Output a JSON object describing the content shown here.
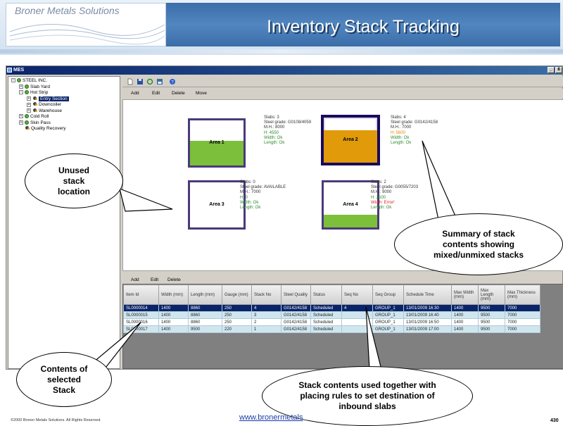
{
  "header": {
    "company": "Broner Metals Solutions",
    "title": "Inventory Stack Tracking"
  },
  "app": {
    "title": "MES",
    "controls": [
      "_",
      "8"
    ]
  },
  "tree": [
    {
      "label": "STEEL INC.",
      "level": 0,
      "exp": "−",
      "icon": "plant"
    },
    {
      "label": "Slab Yard",
      "level": 1,
      "exp": "+",
      "icon": "plant"
    },
    {
      "label": "Hot Strip",
      "level": 1,
      "exp": "−",
      "icon": "plant"
    },
    {
      "label": "Entry Section",
      "level": 2,
      "exp": "+",
      "icon": "gear",
      "selected": true
    },
    {
      "label": "Downcoiler",
      "level": 2,
      "exp": "+",
      "icon": "gear"
    },
    {
      "label": "Warehouse",
      "level": 2,
      "exp": "+",
      "icon": "gear"
    },
    {
      "label": "Cold Roll",
      "level": 1,
      "exp": "+",
      "icon": "plant"
    },
    {
      "label": "Skin Pass",
      "level": 1,
      "exp": "+",
      "icon": "plant"
    },
    {
      "label": "Quality Recovery",
      "level": 1,
      "exp": "",
      "icon": "gear"
    }
  ],
  "toolbar_icons": [
    "new-doc-icon",
    "save-icon",
    "refresh-icon",
    "disk-icon",
    "help-icon"
  ],
  "stack_actions": [
    "Add",
    "Edit",
    "Delete",
    "Move"
  ],
  "areas": [
    {
      "name": "Area 1",
      "fill_fraction": 0.55,
      "fill_color": "#7cbf3a",
      "selected": false,
      "info": [
        {
          "text": "Slabs: 3",
          "cls": ""
        },
        {
          "text": "Steel grade: G0108/4059",
          "cls": ""
        },
        {
          "text": "M.H.: 8000",
          "cls": ""
        },
        {
          "text": "H: 4550",
          "cls": "grn"
        },
        {
          "text": "Width: Ok",
          "cls": "grn"
        },
        {
          "text": "Length: Ok",
          "cls": "grn"
        }
      ]
    },
    {
      "name": "Area 2",
      "fill_fraction": 0.72,
      "fill_color": "#e09a0a",
      "selected": true,
      "info": [
        {
          "text": "Slabs: 4",
          "cls": ""
        },
        {
          "text": "Steel grade: G0142/4158",
          "cls": ""
        },
        {
          "text": "M.H.: 7000",
          "cls": ""
        },
        {
          "text": "H: 5600",
          "cls": "ora"
        },
        {
          "text": "Width: Ok",
          "cls": "grn"
        },
        {
          "text": "Length: Ok",
          "cls": "grn"
        }
      ]
    },
    {
      "name": "Area 3",
      "fill_fraction": 0.0,
      "fill_color": "#ffffff",
      "selected": false,
      "info": [
        {
          "text": "Slabs: 0",
          "cls": ""
        },
        {
          "text": "Steel grade: AVAILABLE",
          "cls": ""
        },
        {
          "text": "M.H.: 7000",
          "cls": ""
        },
        {
          "text": "H: 0",
          "cls": "grn"
        },
        {
          "text": "Width: Ok",
          "cls": "grn"
        },
        {
          "text": "Length: Ok",
          "cls": "grn"
        }
      ]
    },
    {
      "name": "Area 4",
      "fill_fraction": 0.28,
      "fill_color": "#7cbf3a",
      "selected": false,
      "info": [
        {
          "text": "Slabs: 2",
          "cls": ""
        },
        {
          "text": "Steel grade: G0055/7203",
          "cls": ""
        },
        {
          "text": "M.H.: 9000",
          "cls": ""
        },
        {
          "text": "H: 2500",
          "cls": "grn"
        },
        {
          "text": "Width: Error!",
          "cls": "red"
        },
        {
          "text": "Length: Ok",
          "cls": "grn"
        }
      ]
    }
  ],
  "grid_actions": [
    "Add",
    "Edit",
    "Delete"
  ],
  "grid": {
    "columns": [
      "Item Id",
      "Width (mm)",
      "Length (mm)",
      "Gauge (mm)",
      "Stack No",
      "Steel Quality",
      "Status",
      "Seq No",
      "Seq Group",
      "Schedule Time",
      "Max Width (mm)",
      "Max Length (mm)",
      "Max Thickness (mm)"
    ],
    "rows": [
      [
        "SL0000014",
        "1400",
        "8860",
        "250",
        "4",
        "G0142/4158",
        "Scheduled",
        "4",
        "GROUP_1",
        "13/01/2009 16:30",
        "1400",
        "9500",
        "7000"
      ],
      [
        "SL0000015",
        "1400",
        "8860",
        "250",
        "3",
        "G0142/4158",
        "Scheduled",
        "",
        "GROUP_1",
        "13/01/2009 16:40",
        "1400",
        "9500",
        "7000"
      ],
      [
        "SL0000016",
        "1400",
        "8860",
        "250",
        "2",
        "G0142/4158",
        "Scheduled",
        "",
        "GROUP_1",
        "13/01/2009 16:50",
        "1400",
        "9500",
        "7000"
      ],
      [
        "SL0000017",
        "1400",
        "9500",
        "220",
        "1",
        "G0142/4158",
        "Scheduled",
        "",
        "GROUP_1",
        "13/01/2009 17:00",
        "1400",
        "9500",
        "7000"
      ]
    ]
  },
  "callouts": {
    "unused": "Unused stack location",
    "summary": "Summary of stack contents showing mixed/unmixed stacks",
    "contents": "Contents of selected Stack",
    "placing": "Stack contents used together with placing rules to set destination of inbound slabs"
  },
  "footer": {
    "copyright": "©2000 Broner Metals Solutions. All Rights Reserved.",
    "url": "www.bronermetals",
    "page": "430"
  }
}
